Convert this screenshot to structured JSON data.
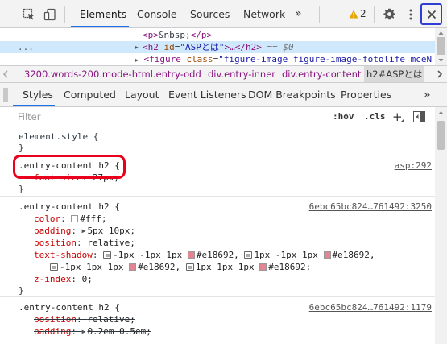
{
  "toolbar": {
    "tabs": [
      "Elements",
      "Console",
      "Sources",
      "Network"
    ],
    "more": "»",
    "warning_count": "2",
    "icons": [
      "inspect-icon",
      "device-toggle-icon",
      "warning-icon",
      "gear-icon",
      "kebab-menu-icon",
      "close-icon"
    ]
  },
  "tree": {
    "line1": {
      "open": "<p>",
      "text": "&nbsp;",
      "close": "</p>"
    },
    "line2": {
      "open": "<h2",
      "attr_name": "id",
      "attr_val": "\"ASPとは\"",
      "ellipsis": ">…</h2>",
      "pseudo": "== $0"
    },
    "line3": {
      "open": "<figure",
      "attr_name": "class",
      "attr_val": "\"figure-image figure-image-fotolife mceN"
    },
    "gutter": "..."
  },
  "breadcrumb": [
    "3200.words-200.mode-html.entry-odd",
    "div.entry-inner",
    "div.entry-content",
    "h2#ASPとは"
  ],
  "subtabs": [
    "Styles",
    "Computed",
    "Layout",
    "Event Listeners",
    "DOM Breakpoints",
    "Properties"
  ],
  "filter": {
    "placeholder": "Filter",
    "hov": ":hov",
    "cls": ".cls",
    "plus": "+"
  },
  "styles": {
    "element_style": {
      "selector": "element.style {",
      "close": "}"
    },
    "rule1": {
      "selector": ".entry-content h2 {",
      "source": "asp:292",
      "decl": {
        "prop": "font-size",
        "val": "27px;"
      },
      "close": "}"
    },
    "rule2": {
      "selector": ".entry-content h2 {",
      "source": "6ebc65bc824…761492:3250",
      "decls": [
        {
          "prop": "color",
          "val": "#fff;"
        },
        {
          "prop": "padding",
          "val": "5px 10px;"
        },
        {
          "prop": "position",
          "val": "relative;"
        },
        {
          "prop": "text-shadow",
          "parts": [
            "-1px -1px 1px",
            "#e18692,",
            "1px -1px 1px",
            "#e18692,"
          ]
        },
        {
          "parts": [
            "-1px 1px 1px",
            "#e18692,",
            "1px 1px 1px",
            "#e18692;"
          ]
        },
        {
          "prop": "z-index",
          "val": "0;"
        }
      ],
      "close": "}"
    },
    "rule3": {
      "selector": ".entry-content h2 {",
      "source": "6ebc65bc824…761492:1179",
      "decls": [
        {
          "prop": "position",
          "val": "relative;"
        },
        {
          "prop": "padding",
          "val": "0.2em 0.5em;"
        }
      ]
    }
  },
  "colors": {
    "accent": "#1a73e8",
    "pink": "#e18692",
    "highlight": "#e8001c",
    "close_box": "#2f3fd4"
  }
}
